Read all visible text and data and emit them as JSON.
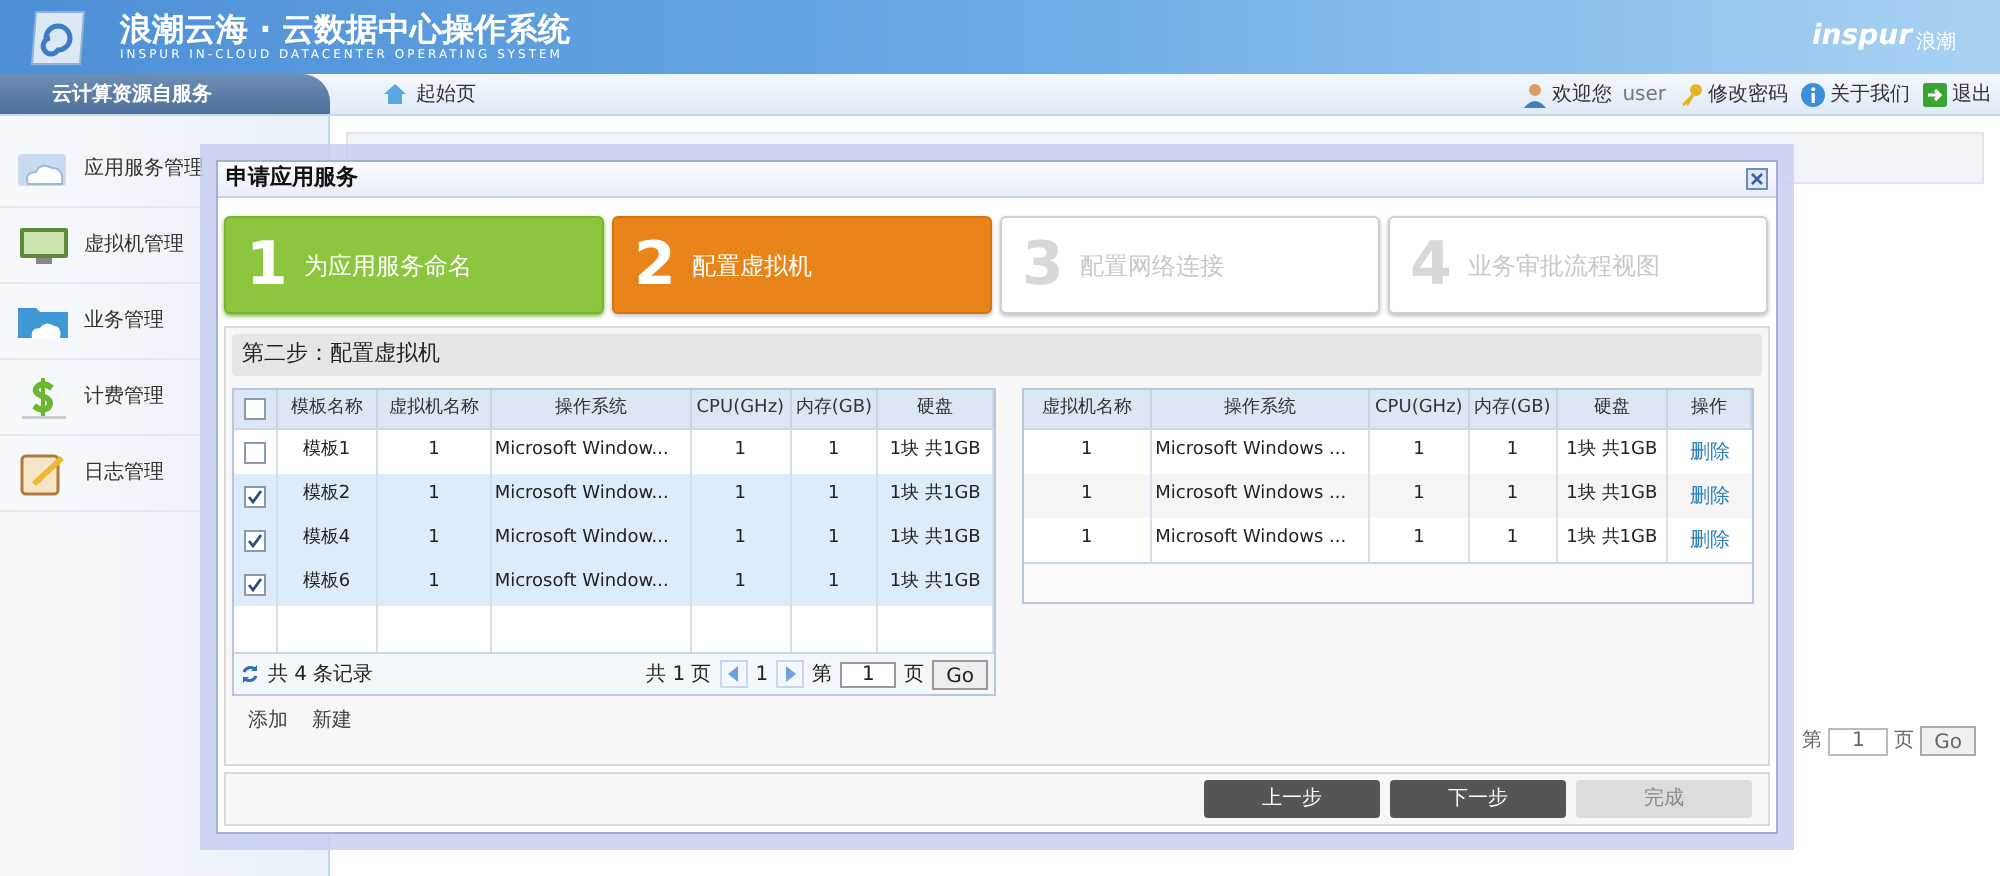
{
  "header": {
    "title": "浪潮云海 · 云数据中心操作系统",
    "subtitle": "INSPUR IN-CLOUD DATACENTER OPERATING SYSTEM",
    "brand": "inspur",
    "brand_cn": "浪潮"
  },
  "nav": {
    "section": "云计算资源自服务",
    "home": "起始页",
    "links": [
      {
        "kind": "user",
        "label": "欢迎您",
        "value": "user"
      },
      {
        "kind": "key",
        "label": "修改密码"
      },
      {
        "kind": "info",
        "label": "关于我们"
      },
      {
        "kind": "exit",
        "label": "退出"
      }
    ]
  },
  "sidebar": {
    "items": [
      {
        "kind": "cloud",
        "label": "应用服务管理"
      },
      {
        "kind": "monitor",
        "label": "虚拟机管理"
      },
      {
        "kind": "folder",
        "label": "业务管理"
      },
      {
        "kind": "dollar",
        "label": "计费管理"
      },
      {
        "kind": "note",
        "label": "日志管理"
      }
    ]
  },
  "background": {
    "pager": {
      "prefix": "第",
      "value": "1",
      "suffix": "页",
      "go": "Go"
    }
  },
  "dialog": {
    "title": "申请应用服务",
    "steps": [
      {
        "number": "1",
        "label": "为应用服务命名",
        "completed": true,
        "selected": false
      },
      {
        "number": "2",
        "label": "配置虚拟机",
        "completed": false,
        "selected": true
      },
      {
        "number": "3",
        "label": "配置网络连接",
        "completed": false,
        "selected": false
      },
      {
        "number": "4",
        "label": "业务审批流程视图",
        "completed": false,
        "selected": false
      }
    ],
    "step_heading": "第二步：配置虚拟机",
    "left_table": {
      "all_checked": false,
      "columns": [
        "模板名称",
        "虚拟机名称",
        "操作系统",
        "CPU(GHz)",
        "内存(GB)",
        "硬盘"
      ],
      "rows": [
        {
          "checked": false,
          "cells": [
            "模板1",
            "1",
            "Microsoft Window...",
            "1",
            "1",
            "1块 共1GB"
          ]
        },
        {
          "checked": true,
          "cells": [
            "模板2",
            "1",
            "Microsoft Window...",
            "1",
            "1",
            "1块 共1GB"
          ]
        },
        {
          "checked": true,
          "cells": [
            "模板4",
            "1",
            "Microsoft Window...",
            "1",
            "1",
            "1块 共1GB"
          ]
        },
        {
          "checked": true,
          "cells": [
            "模板6",
            "1",
            "Microsoft Window...",
            "1",
            "1",
            "1块 共1GB"
          ]
        }
      ],
      "footer": {
        "records": "共 4 条记录",
        "pages": "共 1 页",
        "current": "1",
        "prefix": "第",
        "page_value": "1",
        "suffix": "页",
        "go": "Go"
      }
    },
    "actions": [
      "添加",
      "新建"
    ],
    "right_table": {
      "columns": [
        "虚拟机名称",
        "操作系统",
        "CPU(GHz)",
        "内存(GB)",
        "硬盘",
        "操作"
      ],
      "rows": [
        {
          "cells": [
            "1",
            "Microsoft Windows ...",
            "1",
            "1",
            "1块 共1GB"
          ],
          "action": "删除"
        },
        {
          "cells": [
            "1",
            "Microsoft Windows ...",
            "1",
            "1",
            "1块 共1GB"
          ],
          "action": "删除"
        },
        {
          "cells": [
            "1",
            "Microsoft Windows ...",
            "1",
            "1",
            "1块 共1GB"
          ],
          "action": "删除"
        }
      ]
    },
    "buttons": [
      {
        "label": "上一步",
        "disabled": false
      },
      {
        "label": "下一步",
        "disabled": false
      },
      {
        "label": "完成",
        "disabled": true
      }
    ]
  }
}
